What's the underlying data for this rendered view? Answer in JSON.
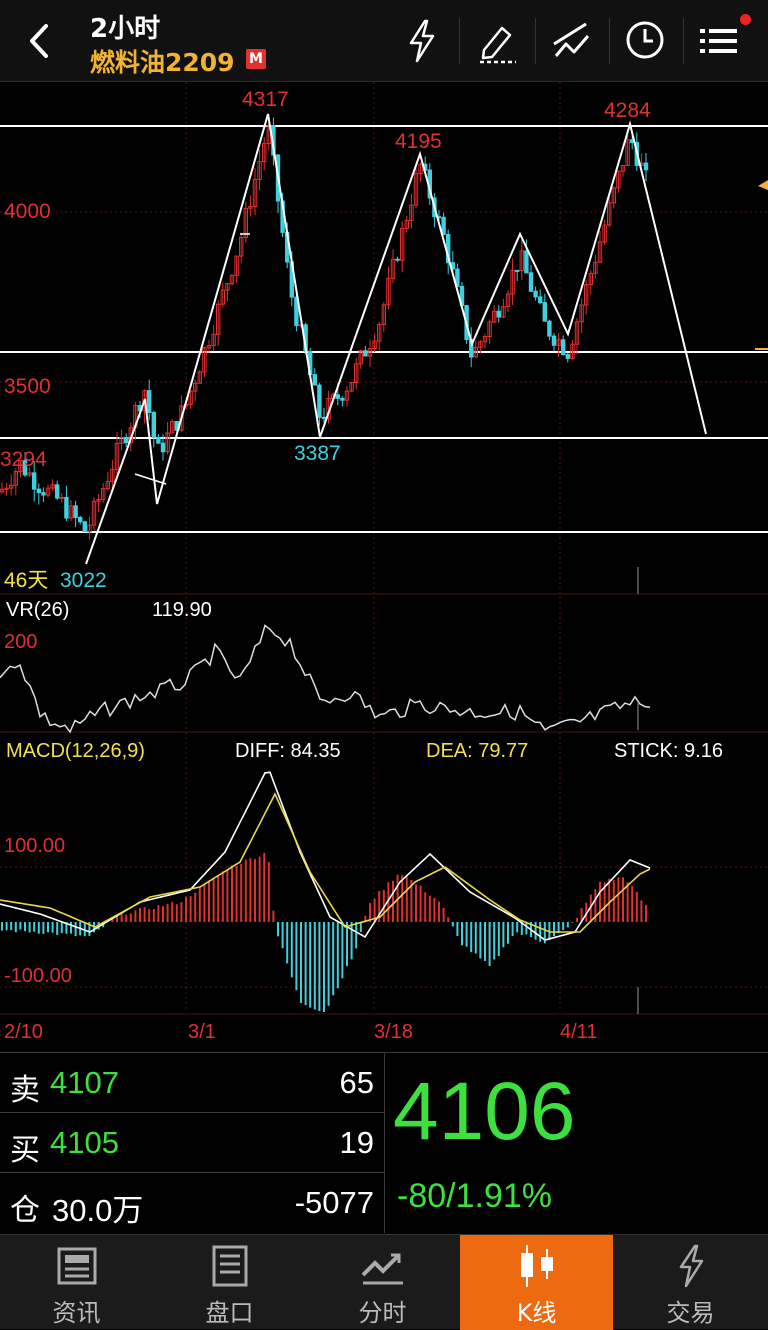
{
  "header": {
    "period": "2小时",
    "contract": "燃料油2209",
    "badge": "M"
  },
  "icons": [
    "back-icon",
    "lightning-icon",
    "pen-icon",
    "draw-lines-icon",
    "clock-icon",
    "menu-icon"
  ],
  "main_chart": {
    "price_labels": {
      "p4000": "4000",
      "p3500": "3500",
      "p3294": "3294"
    },
    "peak_labels": {
      "a": "4317",
      "b": "4195",
      "c": "4284",
      "d": "3387",
      "e": "3022"
    },
    "days_label": "46天"
  },
  "vr": {
    "name": "VR(26)",
    "value": "119.90",
    "axis_label": "200"
  },
  "macd": {
    "name": "MACD(12,26,9)",
    "diff": "DIFF: 84.35",
    "dea": "DEA: 79.77",
    "stick": "STICK: 9.16",
    "axis_pos": "100.00",
    "axis_neg": "-100.00"
  },
  "dates": [
    "2/10",
    "3/1",
    "3/18",
    "4/11"
  ],
  "quote": {
    "sell_label": "卖",
    "sell_price": "4107",
    "sell_vol": "65",
    "buy_label": "买",
    "buy_price": "4105",
    "buy_vol": "19",
    "oi_label": "仓",
    "oi_value": "30.0万",
    "oi_change": "-5077",
    "last": "4106",
    "change": "-80/1.91%"
  },
  "tabs": [
    {
      "label": "资讯",
      "icon": "newspaper-icon"
    },
    {
      "label": "盘口",
      "icon": "order-book-icon"
    },
    {
      "label": "分时",
      "icon": "intraday-chart-icon"
    },
    {
      "label": "K线",
      "icon": "candlestick-icon"
    },
    {
      "label": "交易",
      "icon": "trade-icon"
    }
  ],
  "colors": {
    "up": "#e03030",
    "down": "#3fd0e0",
    "accent": "#ee6a10",
    "price_green": "#3de03d",
    "title_gold": "#f2b233"
  }
}
